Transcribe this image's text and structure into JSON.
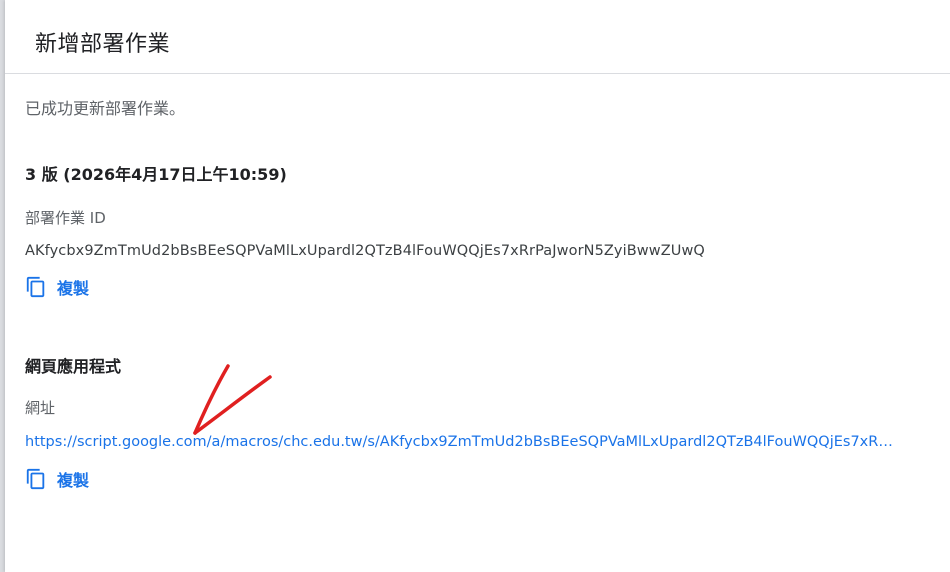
{
  "dialog": {
    "title": "新增部署作業",
    "success_message": "已成功更新部署作業。",
    "version_heading": "3 版 (2026年4月17日上午10:59)",
    "deployment": {
      "label": "部署作業 ID",
      "id": "AKfycbx9ZmTmUd2bBsBEeSQPVaMlLxUpardl2QTzB4lFouWQQjEs7xRrPaJworN5ZyiBwwZUwQ",
      "copy_label": "複製"
    },
    "web_app": {
      "heading": "網頁應用程式",
      "url_label": "網址",
      "url": "https://script.google.com/a/macros/chc.edu.tw/s/AKfycbx9ZmTmUd2bBsBEeSQPVaMlLxUpardl2QTzB4lFouWQQjEs7xR…",
      "copy_label": "複製"
    }
  },
  "colors": {
    "accent": "#1a73e8",
    "annotation_arrow": "#e02020"
  },
  "icons": {
    "copy": "copy-icon"
  }
}
